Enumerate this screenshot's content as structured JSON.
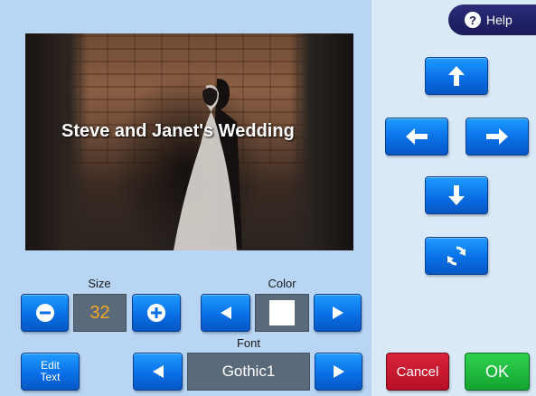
{
  "photo": {
    "caption": "Steve and Janet's Wedding"
  },
  "size": {
    "label": "Size",
    "value": "32"
  },
  "color": {
    "label": "Color",
    "selected_color": "#ffffff"
  },
  "font": {
    "label": "Font",
    "value": "Gothic1"
  },
  "edit_text": {
    "line1": "Edit",
    "line2": "Text"
  },
  "help": {
    "label": "Help"
  },
  "actions": {
    "cancel_label": "Cancel",
    "ok_label": "OK"
  },
  "colors": {
    "button_blue": "#0a6fe6",
    "cancel_red": "#c0162c",
    "ok_green": "#1cb63c",
    "value_text_orange": "#f5a623",
    "help_navy": "#1f1f66"
  },
  "icons": {
    "move_up": "arrow-up-icon",
    "move_left": "arrow-left-icon",
    "move_right": "arrow-right-icon",
    "move_down": "arrow-down-icon",
    "rotate": "rotate-icon",
    "size_decrease": "minus-icon",
    "size_increase": "plus-icon",
    "prev": "triangle-left-icon",
    "next": "triangle-right-icon",
    "help": "question-icon"
  }
}
